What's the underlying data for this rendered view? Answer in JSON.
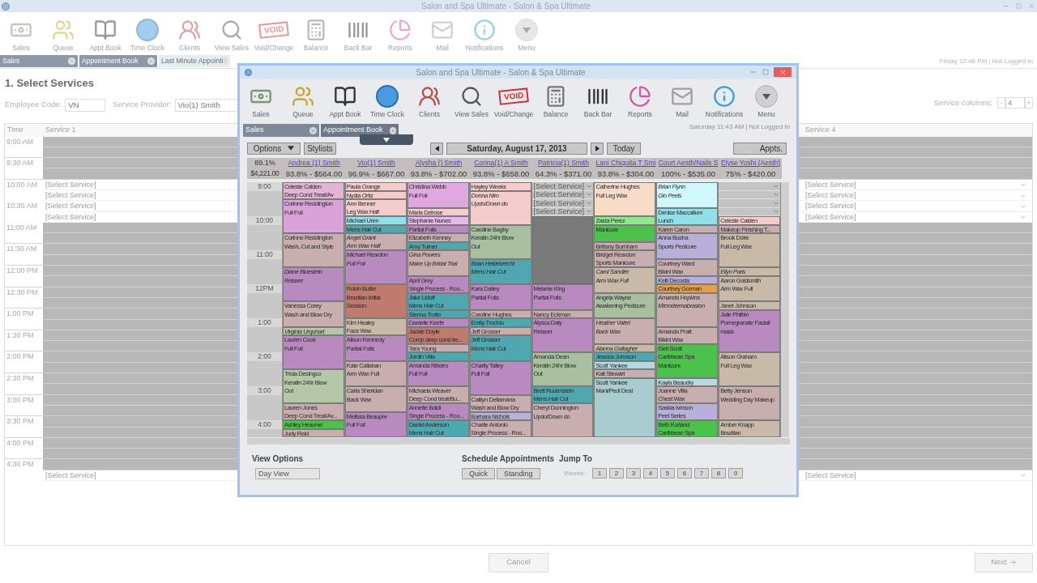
{
  "window": {
    "title": "Salon and Spa Ultimate - Salon & Spa Ultimate",
    "status": "Friday 12:46 PM | Not Logged In"
  },
  "toolbar": [
    {
      "label": "Sales",
      "kind": "sales"
    },
    {
      "label": "Queue",
      "kind": "queue"
    },
    {
      "label": "Appt Book",
      "kind": "appt_book"
    },
    {
      "label": "Time Clock",
      "kind": "time_clock"
    },
    {
      "label": "Clients",
      "kind": "clients"
    },
    {
      "label": "View Sales",
      "kind": "view_sales"
    },
    {
      "label": "Void/Change",
      "kind": "void",
      "badge": "VOID"
    },
    {
      "label": "Balance",
      "kind": "balance"
    },
    {
      "label": "Back Bar",
      "kind": "back_bar"
    },
    {
      "label": "Reports",
      "kind": "reports"
    },
    {
      "label": "Mail",
      "kind": "mail"
    },
    {
      "label": "Notifications",
      "kind": "notifications"
    },
    {
      "label": "Menu",
      "kind": "menu"
    }
  ],
  "tabs": [
    {
      "label": "Sales",
      "selected": false
    },
    {
      "label": "Appointment Book",
      "selected": false
    },
    {
      "label": "Last Minute Appointi",
      "selected": true
    }
  ],
  "page": {
    "heading": "1. Select Services",
    "employee_code": {
      "label": "Employee Code:",
      "value": "VN"
    },
    "service_provider": {
      "label": "Service Provider:",
      "value": "Vio(1) Smith"
    },
    "service_columns": {
      "label": "Service columns:",
      "decrement": "-",
      "value": "4",
      "increment": "+"
    }
  },
  "grid": {
    "columns": [
      "Time",
      "Service 1",
      "Service 4"
    ],
    "rows": [
      {
        "time": "9:00 AM",
        "available": false
      },
      {
        "available": false
      },
      {
        "time": "9:30 AM",
        "available": false
      },
      {
        "available": false
      },
      {
        "time": "10:00 AM",
        "available": true,
        "services": [
          "[Select Service]",
          "[Select Service]"
        ]
      },
      {
        "available": true,
        "services": [
          "[Select Service]",
          "[Select Service]"
        ]
      },
      {
        "time": "10:30 AM",
        "available": true,
        "services": [
          "[Select Service]",
          "[Select Service]"
        ]
      },
      {
        "available": true,
        "services": [
          "[Select Service]",
          "[Select Service]"
        ]
      },
      {
        "time": "11:00 AM",
        "available": false
      },
      {
        "available": false
      },
      {
        "time": "11:30 AM",
        "available": false
      },
      {
        "available": false
      },
      {
        "time": "12:00 PM",
        "available": false
      },
      {
        "available": false
      },
      {
        "time": "12:30 PM",
        "available": false
      },
      {
        "available": false
      },
      {
        "time": "1:00 PM",
        "available": false
      },
      {
        "available": false
      },
      {
        "time": "1:30 PM",
        "available": false
      },
      {
        "available": false
      },
      {
        "time": "2:00 PM",
        "available": false
      },
      {
        "available": false
      },
      {
        "time": "2:30 PM",
        "available": false
      },
      {
        "available": false
      },
      {
        "time": "3:00 PM",
        "available": false
      },
      {
        "available": false
      },
      {
        "time": "3:30 PM",
        "available": false
      },
      {
        "available": false
      },
      {
        "time": "4:00 PM",
        "available": false
      },
      {
        "available": false
      },
      {
        "time": "4:30 PM",
        "available": false
      },
      {
        "available": true,
        "services": [
          "[Select Service]",
          "[Select Service]"
        ]
      }
    ]
  },
  "buttons": {
    "cancel": "Cancel",
    "next": "Next"
  },
  "appointment_window": {
    "title": "Salon and Spa Ultimate - Salon & Spa Ultimate",
    "status": "Saturday 11:43 AM | Not Logged In",
    "toolbar": [
      {
        "label": "Sales",
        "kind": "sales"
      },
      {
        "label": "Queue",
        "kind": "queue"
      },
      {
        "label": "Appt Book",
        "kind": "appt_book"
      },
      {
        "label": "Time Clock",
        "kind": "time_clock"
      },
      {
        "label": "Clients",
        "kind": "clients"
      },
      {
        "label": "View Sales",
        "kind": "view_sales"
      },
      {
        "label": "Void/Change",
        "kind": "void",
        "badge": "VOID"
      },
      {
        "label": "Balance",
        "kind": "balance"
      },
      {
        "label": "Back Bar",
        "kind": "back_bar"
      },
      {
        "label": "Reports",
        "kind": "reports"
      },
      {
        "label": "Mail",
        "kind": "mail"
      },
      {
        "label": "Notifications",
        "kind": "notifications"
      },
      {
        "label": "Menu",
        "kind": "menu"
      }
    ],
    "tabs": [
      {
        "label": "Sales",
        "selected": false
      },
      {
        "label": "Appointment Book",
        "selected": true
      }
    ],
    "controls": {
      "options": "Options",
      "stylists": "Stylists",
      "date": "Saturday, August 17, 2013",
      "today": "Today",
      "appts": "Appts."
    },
    "summary": {
      "percent": "89.1%",
      "total": "$4,221.00"
    },
    "stylists": [
      {
        "name": "Andrea (1) Smith",
        "stats": "93.8% - $564.00"
      },
      {
        "name": "Vio(1) Smith",
        "stats": "96.9% - $667.00"
      },
      {
        "name": "Alysha () Smith",
        "stats": "93.8% - $702.00"
      },
      {
        "name": "Corina(1) A Smith",
        "stats": "93.8% - $658.00"
      },
      {
        "name": "Patricia(1) Smith",
        "stats": "64.3% - $371.00"
      },
      {
        "name": "Lani Chiquita T Smi",
        "stats": "93.8% - $304.00"
      },
      {
        "name": "Court Aesth/Nails S",
        "stats": "100% - $535.00"
      },
      {
        "name": "Elyse Yoshi (Aesth)",
        "stats": "75% - $420.00"
      }
    ],
    "time_labels": [
      "9:00",
      "10:00",
      "11:00",
      "12PM",
      "1:00",
      "2:00",
      "3:00",
      "4:00"
    ],
    "columns": [
      {
        "entries": [
          {
            "kind": "appointment",
            "lines": [
              "Celeste Calden",
              "Deep Cond Treat/Av"
            ],
            "color": "#e4b4d4",
            "italic": false
          },
          {
            "kind": "appointment",
            "lines": [
              "Corinne Reddington",
              "Full Foil"
            ],
            "color": "#d9a3d9",
            "italic": false
          },
          {
            "kind": "more"
          },
          {
            "kind": "more"
          },
          {
            "kind": "appointment",
            "lines": [
              "Corinne Reddington",
              "Wash, Cut and Style"
            ],
            "color": "#c9aeb0",
            "italic": false
          },
          {
            "kind": "more"
          },
          {
            "kind": "more"
          },
          {
            "kind": "appointment",
            "lines": [
              "Diane Bluestein",
              "Relaxer"
            ],
            "color": "#b98ac0",
            "italic": true
          },
          {
            "kind": "more"
          },
          {
            "kind": "more"
          },
          {
            "kind": "appointment",
            "lines": [
              "Vanessa Corey",
              "Wash and Blow Dry"
            ],
            "color": "#c9aeb0",
            "italic": false
          },
          {
            "kind": "more"
          },
          {
            "kind": "appointment",
            "lines": [
              "Virginia Urquhart"
            ],
            "color": "#b4c8a8",
            "italic": true
          },
          {
            "kind": "appointment",
            "lines": [
              "Lauren Cook",
              "Full Foil"
            ],
            "color": "#b98ac0",
            "italic": false
          },
          {
            "kind": "more"
          },
          {
            "kind": "more"
          },
          {
            "kind": "appointment",
            "lines": [
              "Tricia Desingco",
              "Keratin 24hr Blow",
              "Out"
            ],
            "color": "#b4c8a8",
            "italic": false
          },
          {
            "kind": "more"
          },
          {
            "kind": "appointment",
            "lines": [
              "Lauren Jones",
              "Deep Cond Treat/Av..."
            ],
            "color": "#c9aeb0",
            "italic": false
          },
          {
            "kind": "appointment",
            "lines": [
              "Ashley Heavner"
            ],
            "color": "#4cc24c",
            "italic": false
          },
          {
            "kind": "appointment",
            "lines": [
              "Judy Reid"
            ],
            "color": "#c9aeb0",
            "italic": false
          }
        ]
      },
      {
        "entries": [
          {
            "kind": "appointment",
            "lines": [
              "Paula Orange"
            ],
            "color": "#f4cccc",
            "italic": false
          },
          {
            "kind": "appointment",
            "lines": [
              "Nydia Ortiz"
            ],
            "color": "#f4cccc",
            "italic": false
          },
          {
            "kind": "appointment",
            "lines": [
              "Ann Benner",
              "Leg Wax Half"
            ],
            "color": "#f4cccc",
            "italic": false
          },
          {
            "kind": "appointment",
            "lines": [
              "Michael Uren"
            ],
            "color": "#8fe0e8",
            "italic": false
          },
          {
            "kind": "appointment",
            "lines": [
              "Mens Hair Cut"
            ],
            "color": "#4fa8b0",
            "italic": false
          },
          {
            "kind": "appointment",
            "lines": [
              "Angel Grant",
              "Arm Wax Half"
            ],
            "color": "#c9aeb0",
            "italic": true
          },
          {
            "kind": "appointment",
            "lines": [
              "Michael Reardon",
              "Full Foil"
            ],
            "color": "#b98ac0",
            "italic": true
          },
          {
            "kind": "more"
          },
          {
            "kind": "more"
          },
          {
            "kind": "appointment",
            "lines": [
              "Robin Butler",
              "Brazilian Initial",
              "Session"
            ],
            "color": "#c07a6e",
            "italic": false
          },
          {
            "kind": "more"
          },
          {
            "kind": "appointment",
            "lines": [
              "Kim Healey",
              "Face Wax"
            ],
            "color": "#c9b9a8",
            "italic": false
          },
          {
            "kind": "appointment",
            "lines": [
              "Alison Kennedy",
              "Partial Foils"
            ],
            "color": "#b98ac0",
            "italic": false
          },
          {
            "kind": "more"
          },
          {
            "kind": "appointment",
            "lines": [
              "Kate Callahan",
              "Arm Wax Full"
            ],
            "color": "#c9aeb0",
            "italic": false
          },
          {
            "kind": "more"
          },
          {
            "kind": "appointment",
            "lines": [
              "Carla Sheridan",
              "Back Wax"
            ],
            "color": "#c9aeb0",
            "italic": false
          },
          {
            "kind": "more"
          },
          {
            "kind": "appointment",
            "lines": [
              "Melissa Beaupre",
              "Full Foil"
            ],
            "color": "#b98ac0",
            "italic": false
          },
          {
            "kind": "more"
          }
        ]
      },
      {
        "entries": [
          {
            "kind": "appointment",
            "lines": [
              "Christina Webb",
              "Full Foil"
            ],
            "color": "#e0a8e0",
            "italic": false
          },
          {
            "kind": "more"
          },
          {
            "kind": "appointment",
            "lines": [
              "Maria Delrose"
            ],
            "color": "#f4cccc",
            "italic": false
          },
          {
            "kind": "appointment",
            "lines": [
              "Stephanie Nunes"
            ],
            "color": "#e8b8e8",
            "italic": false
          },
          {
            "kind": "appointment",
            "lines": [
              "Partial Foils"
            ],
            "color": "#b98ac0",
            "italic": false
          },
          {
            "kind": "appointment",
            "lines": [
              "Elizabeth Kenney"
            ],
            "color": "#c9aeb0",
            "italic": false
          },
          {
            "kind": "appointment",
            "lines": [
              "Amy Turner"
            ],
            "color": "#4fa8b0",
            "italic": false
          },
          {
            "kind": "appointment",
            "lines": [
              "Gina Powers",
              "Make Up Bridal Trial"
            ],
            "color": "#c9aeb0",
            "italic": true
          },
          {
            "kind": "more"
          },
          {
            "kind": "appointment",
            "lines": [
              "April Grey",
              "Single Process - Roo..."
            ],
            "color": "#b98ac0",
            "italic": false
          },
          {
            "kind": "appointment",
            "lines": [
              "Jake Udoff",
              "Mens Hair Cut"
            ],
            "color": "#4fa8b0",
            "italic": false
          },
          {
            "kind": "appointment",
            "lines": [
              "Sienna Trotto"
            ],
            "color": "#4fa8b0",
            "italic": false
          },
          {
            "kind": "appointment",
            "lines": [
              "Danielle Keefe"
            ],
            "color": "#b98ac0",
            "italic": false
          },
          {
            "kind": "appointment",
            "lines": [
              "Jackie Doyle",
              "Comp deep cond tre..."
            ],
            "color": "#c07a6e",
            "italic": false
          },
          {
            "kind": "appointment",
            "lines": [
              "Tara Young"
            ],
            "color": "#c9aeb0",
            "italic": false
          },
          {
            "kind": "appointment",
            "lines": [
              "Jordin Villa"
            ],
            "color": "#4fa8b0",
            "italic": false
          },
          {
            "kind": "appointment",
            "lines": [
              "Amanda Ribeiro",
              "Full Foil"
            ],
            "color": "#b98ac0",
            "italic": false
          },
          {
            "kind": "more"
          },
          {
            "kind": "appointment",
            "lines": [
              "Michaela Weaver",
              "Deep Cond treat/Bu..."
            ],
            "color": "#c9aeb0",
            "italic": false
          },
          {
            "kind": "appointment",
            "lines": [
              "Annette Baldi",
              "Single Process - Roo..."
            ],
            "color": "#b98ac0",
            "italic": false
          },
          {
            "kind": "appointment",
            "lines": [
              "Daniel Anderson",
              "Mens Hair Cut"
            ],
            "color": "#4fa8b0",
            "italic": false
          }
        ]
      },
      {
        "entries": [
          {
            "kind": "appointment",
            "lines": [
              "Hayley Weeks"
            ],
            "color": "#f4cccc",
            "italic": false
          },
          {
            "kind": "appointment",
            "lines": [
              "Donna Niro",
              "Updo/Down do"
            ],
            "color": "#f4cccc",
            "italic": true
          },
          {
            "kind": "more"
          },
          {
            "kind": "more"
          },
          {
            "kind": "appointment",
            "lines": [
              "Caroline Bagby",
              "Keratin 24hr Blow",
              "Out"
            ],
            "color": "#a8c0a0",
            "italic": false
          },
          {
            "kind": "more"
          },
          {
            "kind": "appointment",
            "lines": [
              "Brian Heidebrecht",
              "Mens Hair Cut"
            ],
            "color": "#4fa8b0",
            "italic": true
          },
          {
            "kind": "more"
          },
          {
            "kind": "appointment",
            "lines": [
              "Kara Dailey",
              "Partial Foils"
            ],
            "color": "#b98ac0",
            "italic": false
          },
          {
            "kind": "more"
          },
          {
            "kind": "appointment",
            "lines": [
              "Caroline Hughes"
            ],
            "color": "#c9aeb0",
            "italic": false
          },
          {
            "kind": "appointment",
            "lines": [
              "Emily Trochio"
            ],
            "color": "#4fa8b0",
            "italic": false
          },
          {
            "kind": "appointment",
            "lines": [
              "Jeff Grosser"
            ],
            "color": "#c9aeb0",
            "italic": false
          },
          {
            "kind": "appointment",
            "lines": [
              "Jeff Grosser",
              "Mens Hair Cut"
            ],
            "color": "#4fa8b0",
            "italic": false
          },
          {
            "kind": "more"
          },
          {
            "kind": "appointment",
            "lines": [
              "Charity Talley",
              "Full Foil"
            ],
            "color": "#b98ac0",
            "italic": false
          },
          {
            "kind": "more"
          },
          {
            "kind": "more"
          },
          {
            "kind": "appointment",
            "lines": [
              "Caitlyn Dellamana",
              "Wash and Blow Dry"
            ],
            "color": "#c9aeb0",
            "italic": false
          },
          {
            "kind": "appointment",
            "lines": [
              "Barbara Nichols"
            ],
            "color": "#b8b0d8",
            "italic": false
          },
          {
            "kind": "appointment",
            "lines": [
              "Charlie Antonio",
              "Single Process - Roo..."
            ],
            "color": "#c9aeb0",
            "italic": false
          }
        ]
      },
      {
        "entries": [
          {
            "kind": "select",
            "text": "[Select Service]"
          },
          {
            "kind": "select",
            "text": "[Select Service]"
          },
          {
            "kind": "select",
            "text": "[Select Service]"
          },
          {
            "kind": "select",
            "text": "[Select Service]"
          },
          {
            "kind": "blocked"
          },
          {
            "kind": "more"
          },
          {
            "kind": "more"
          },
          {
            "kind": "more"
          },
          {
            "kind": "more"
          },
          {
            "kind": "more"
          },
          {
            "kind": "more"
          },
          {
            "kind": "more"
          },
          {
            "kind": "appointment",
            "lines": [
              "Melanie King",
              "Partial Foils"
            ],
            "color": "#b98ac0",
            "italic": false
          },
          {
            "kind": "more"
          },
          {
            "kind": "appointment",
            "lines": [
              "Nancy Eckman"
            ],
            "color": "#c9aeb0",
            "italic": false
          },
          {
            "kind": "appointment",
            "lines": [
              "Alyssa Daly",
              "Relaxer"
            ],
            "color": "#b98ac0",
            "italic": false
          },
          {
            "kind": "more"
          },
          {
            "kind": "more"
          },
          {
            "kind": "appointment",
            "lines": [
              "Amanda Dean",
              "Keratin 24hr Blow",
              "Out"
            ],
            "color": "#a8c0a0",
            "italic": false
          },
          {
            "kind": "more"
          },
          {
            "kind": "appointment",
            "lines": [
              "Brett Rudenstein",
              "Mens Hair Cut"
            ],
            "color": "#4fa8b0",
            "italic": false
          },
          {
            "kind": "appointment",
            "lines": [
              "Cheryl Dunnington",
              "Updo/Down do"
            ],
            "color": "#c9aeb0",
            "italic": false
          },
          {
            "kind": "more"
          },
          {
            "kind": "more"
          }
        ]
      },
      {
        "entries": [
          {
            "kind": "appointment",
            "lines": [
              "Catherine Hughes",
              "Full Leg Wax"
            ],
            "color": "#f8dcc8",
            "italic": false
          },
          {
            "kind": "more"
          },
          {
            "kind": "more"
          },
          {
            "kind": "appointment",
            "lines": [
              "Zaida Perez"
            ],
            "color": "#8fe88a",
            "italic": false
          },
          {
            "kind": "appointment",
            "lines": [
              "Manicure"
            ],
            "color": "#4cc24c",
            "italic": false
          },
          {
            "kind": "more"
          },
          {
            "kind": "appointment",
            "lines": [
              "Brittany Burnham"
            ],
            "color": "#c9aeb0",
            "italic": false
          },
          {
            "kind": "appointment",
            "lines": [
              "Bridget Reardon",
              "Sports Manicure"
            ],
            "color": "#c9aeb0",
            "italic": false
          },
          {
            "kind": "appointment",
            "lines": [
              "Carol Sandler",
              "Arm Wax Full"
            ],
            "color": "#c9b9a8",
            "italic": true
          },
          {
            "kind": "more"
          },
          {
            "kind": "appointment",
            "lines": [
              "Angela Wayne",
              "Awakening Pedicure"
            ],
            "color": "#a8c0a0",
            "italic": false
          },
          {
            "kind": "more"
          },
          {
            "kind": "appointment",
            "lines": [
              "Heather Valeri",
              "Back Wax"
            ],
            "color": "#c9aeb0",
            "italic": true
          },
          {
            "kind": "more"
          },
          {
            "kind": "appointment",
            "lines": [
              "Alanna Gallagher"
            ],
            "color": "#c9b9a8",
            "italic": true
          },
          {
            "kind": "appointment",
            "lines": [
              "Jessica Johnson"
            ],
            "color": "#4fa8b0",
            "italic": false
          },
          {
            "kind": "appointment",
            "lines": [
              "Scott Yankee"
            ],
            "color": "#b8d8e0",
            "italic": false
          },
          {
            "kind": "appointment",
            "lines": [
              "Kait Stewart"
            ],
            "color": "#c9aeb0",
            "italic": false
          },
          {
            "kind": "appointment",
            "lines": [
              "Scott Yankee",
              "Mani/Pedi Deal"
            ],
            "color": "#a8ccd0",
            "italic": false
          },
          {
            "kind": "more"
          },
          {
            "kind": "more"
          },
          {
            "kind": "more"
          },
          {
            "kind": "more"
          },
          {
            "kind": "more"
          }
        ]
      },
      {
        "entries": [
          {
            "kind": "appointment",
            "lines": [
              "Brian Flynn",
              "Glo Peels"
            ],
            "color": "#d0f8fc",
            "italic": true
          },
          {
            "kind": "more"
          },
          {
            "kind": "appointment",
            "lines": [
              "Denise Maccallum",
              "Lunch"
            ],
            "color": "#8fe0e8",
            "italic": false
          },
          {
            "kind": "appointment",
            "lines": [
              "Karen Caron"
            ],
            "color": "#c9aeb0",
            "italic": false
          },
          {
            "kind": "appointment",
            "lines": [
              "Anna Busha",
              "Sports Pedicure"
            ],
            "color": "#b8b0d8",
            "italic": false
          },
          {
            "kind": "more"
          },
          {
            "kind": "appointment",
            "lines": [
              "Courtney Ward",
              "Bikini Wax"
            ],
            "color": "#c9aeb0",
            "italic": false
          },
          {
            "kind": "appointment",
            "lines": [
              "Kelli Decosta"
            ],
            "color": "#b8b0d8",
            "italic": false
          },
          {
            "kind": "appointment",
            "lines": [
              "Courtney Gorman"
            ],
            "color": "#e0a050",
            "italic": false
          },
          {
            "kind": "appointment",
            "lines": [
              "Amanda Hopkins",
              "Microdermabrasion"
            ],
            "color": "#c9aeb0",
            "italic": true
          },
          {
            "kind": "more"
          },
          {
            "kind": "more"
          },
          {
            "kind": "appointment",
            "lines": [
              "Amanda Pratt",
              "Bikini Wax"
            ],
            "color": "#c9aeb0",
            "italic": false
          },
          {
            "kind": "appointment",
            "lines": [
              "Geri Scott",
              "Caribbean Spa",
              "Manicure"
            ],
            "color": "#4cc24c",
            "italic": false
          },
          {
            "kind": "more"
          },
          {
            "kind": "appointment",
            "lines": [
              "Kayla Beaudry"
            ],
            "color": "#b8d8e0",
            "italic": false
          },
          {
            "kind": "appointment",
            "lines": [
              "Joanne Villa",
              "Chest Wax"
            ],
            "color": "#c9aeb0",
            "italic": false
          },
          {
            "kind": "appointment",
            "lines": [
              "Saskia Ivinson",
              "Peel Series"
            ],
            "color": "#b8b0d8",
            "italic": false
          },
          {
            "kind": "appointment",
            "lines": [
              "Beth Kurland",
              "Caribbean Spa"
            ],
            "color": "#4cc24c",
            "italic": false
          }
        ]
      },
      {
        "entries": [
          {
            "kind": "dropdown"
          },
          {
            "kind": "dropdown"
          },
          {
            "kind": "dropdown"
          },
          {
            "kind": "dropdown"
          },
          {
            "kind": "appointment",
            "lines": [
              "Celeste Calden"
            ],
            "color": "#f4cccc",
            "italic": false
          },
          {
            "kind": "appointment",
            "lines": [
              "Makeup Finishing T..."
            ],
            "color": "#c9aeb0",
            "italic": false
          },
          {
            "kind": "appointment",
            "lines": [
              "Brook Doire",
              "Full Leg Wax"
            ],
            "color": "#c9b9a8",
            "italic": false
          },
          {
            "kind": "more"
          },
          {
            "kind": "more"
          },
          {
            "kind": "appointment",
            "lines": [
              "Ellyn Paris"
            ],
            "color": "#c9b9a8",
            "italic": true
          },
          {
            "kind": "appointment",
            "lines": [
              "Aaron Goldsmith",
              "Arm Wax Full"
            ],
            "color": "#c9b9a8",
            "italic": false
          },
          {
            "kind": "more"
          },
          {
            "kind": "appointment",
            "lines": [
              "Janet Johnson"
            ],
            "color": "#c9b9a8",
            "italic": false
          },
          {
            "kind": "appointment",
            "lines": [
              "Julie Philbin",
              "Pomegranate Facial/",
              "mask"
            ],
            "color": "#b98ac0",
            "italic": false
          },
          {
            "kind": "more"
          },
          {
            "kind": "more"
          },
          {
            "kind": "appointment",
            "lines": [
              "Alison Graham",
              "Full Leg Wax"
            ],
            "color": "#c9b9a8",
            "italic": false
          },
          {
            "kind": "more"
          },
          {
            "kind": "more"
          },
          {
            "kind": "appointment",
            "lines": [
              "Betty Jenson",
              "Wedding Day Makeup"
            ],
            "color": "#c9aeb0",
            "italic": false
          },
          {
            "kind": "more"
          },
          {
            "kind": "more"
          },
          {
            "kind": "appointment",
            "lines": [
              "Amber Knapp",
              "Brazilian"
            ],
            "color": "#c9b9a8",
            "italic": false
          }
        ]
      }
    ],
    "view_options": {
      "label": "View Options",
      "view": "Day View"
    },
    "schedule": {
      "label": "Schedule Appointments",
      "buttons": [
        "Quick",
        "Standing"
      ]
    },
    "jump_to": {
      "label": "Jump To",
      "weeks_label": "Weeks:",
      "weeks": [
        "1",
        "2",
        "3",
        "4",
        "5",
        "6",
        "7",
        "8",
        "9"
      ]
    }
  }
}
